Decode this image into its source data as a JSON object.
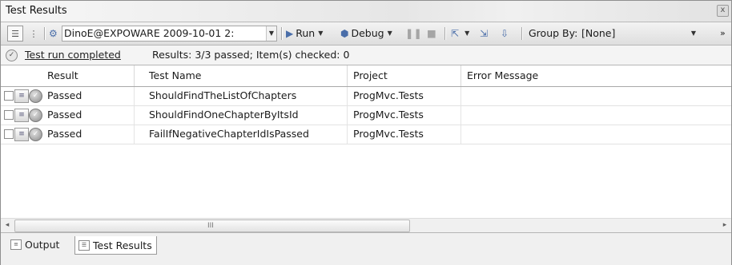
{
  "window": {
    "title": "Test Results",
    "close_glyph": "x"
  },
  "toolbar": {
    "run_config": "DinoE@EXPOWARE 2009-10-01 2:",
    "run_label": "Run",
    "debug_label": "Debug",
    "group_by_label": "Group By:",
    "group_by_value": "[None]",
    "overflow_glyph": "»"
  },
  "status": {
    "link_text": "Test run completed",
    "message": "Results: 3/3 passed;  Item(s) checked: 0"
  },
  "grid": {
    "columns": [
      "Result",
      "Test Name",
      "Project",
      "Error Message"
    ],
    "rows": [
      {
        "result": "Passed",
        "test_name": "ShouldFindTheListOfChapters",
        "project": "ProgMvc.Tests",
        "error": ""
      },
      {
        "result": "Passed",
        "test_name": "ShouldFindOneChapterByItsId",
        "project": "ProgMvc.Tests",
        "error": ""
      },
      {
        "result": "Passed",
        "test_name": "FailIfNegativeChapterIdIsPassed",
        "project": "ProgMvc.Tests",
        "error": ""
      }
    ]
  },
  "scrollbar": {
    "left_glyph": "◂",
    "right_glyph": "▸",
    "grip": "III"
  },
  "bottom_tabs": [
    "Output",
    "Test Results"
  ],
  "icons": {
    "status_ok": "check-circle-icon",
    "test_item": "test-document-icon",
    "passed": "passed-check-icon",
    "toolbar": [
      "tree-view-icon",
      "hierarchy-icon",
      "run-config-icon",
      "run-icon",
      "debug-icon",
      "pause-icon",
      "stop-icon",
      "export-icon",
      "import-icon",
      "publish-icon"
    ]
  },
  "colors": {
    "accent": "#4a6ea9",
    "status_bg": "#f4f4f4",
    "titlebar_bg": "#e6e6e6"
  }
}
